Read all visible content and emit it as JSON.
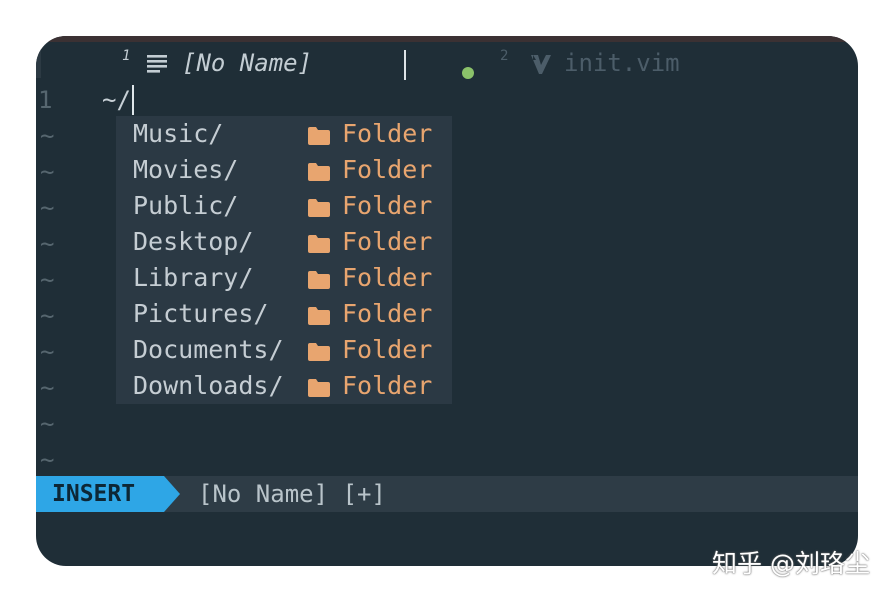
{
  "tabs": [
    {
      "number": "1",
      "title": "[No Name]",
      "icon": "lines-icon",
      "modified": true,
      "active": true
    },
    {
      "number": "2",
      "title": "init.vim",
      "icon": "vim-icon",
      "active": false
    }
  ],
  "editor": {
    "line_number": "1",
    "line_text": "~/",
    "tilde": "~",
    "empty_line_count": 10
  },
  "completion": {
    "items": [
      {
        "name": "Music/",
        "kind": "Folder"
      },
      {
        "name": "Movies/",
        "kind": "Folder"
      },
      {
        "name": "Public/",
        "kind": "Folder"
      },
      {
        "name": "Desktop/",
        "kind": "Folder"
      },
      {
        "name": "Library/",
        "kind": "Folder"
      },
      {
        "name": "Pictures/",
        "kind": "Folder"
      },
      {
        "name": "Documents/",
        "kind": "Folder"
      },
      {
        "name": "Downloads/",
        "kind": "Folder"
      }
    ],
    "kind_icon": "folder-icon"
  },
  "statusline": {
    "mode": "INSERT",
    "file": "[No Name] [+]"
  },
  "watermark": "知乎 @刘珞尘",
  "colors": {
    "background": "#1f2e37",
    "mode_accent": "#2ea6e6",
    "folder": "#e8a56f",
    "modified_dot": "#8bc26a"
  }
}
